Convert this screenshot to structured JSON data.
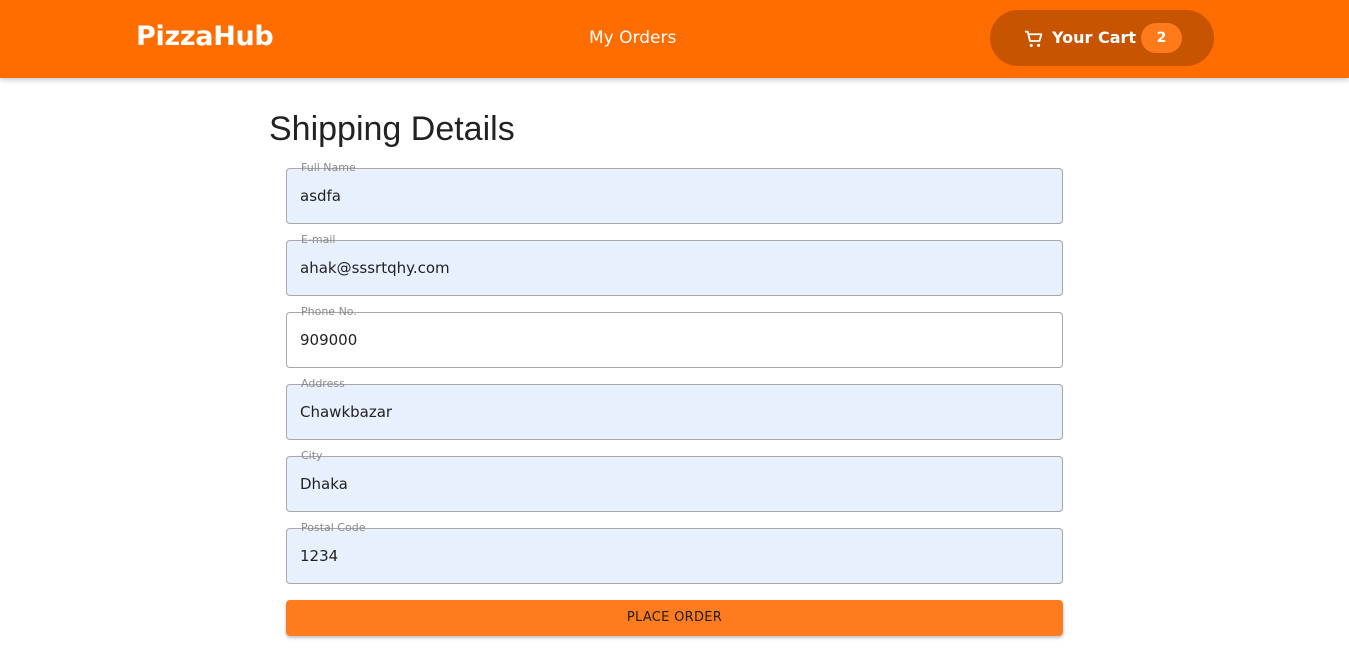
{
  "navbar": {
    "brand": "PizzaHub",
    "orders_link": "My Orders",
    "cart": {
      "label": "Your Cart",
      "count": "2",
      "icon": "shopping-cart-icon"
    }
  },
  "page": {
    "title": "Shipping Details"
  },
  "form": {
    "fields": [
      {
        "label": "Full Name",
        "value": "asdfa"
      },
      {
        "label": "E-mail",
        "value": "ahak@sssrtqhy.com"
      },
      {
        "label": "Phone No.",
        "value": "909000"
      },
      {
        "label": "Address",
        "value": "Chawkbazar"
      },
      {
        "label": "City",
        "value": "Dhaka"
      },
      {
        "label": "Postal Code",
        "value": "1234"
      }
    ],
    "submit_label": "PLACE ORDER"
  },
  "colors": {
    "primary": "#ff6d00",
    "cart_button": "#c75400",
    "badge": "#ff7a1a",
    "submit_button": "#ff7c1e",
    "autofill_background": "#e8f0fe"
  }
}
